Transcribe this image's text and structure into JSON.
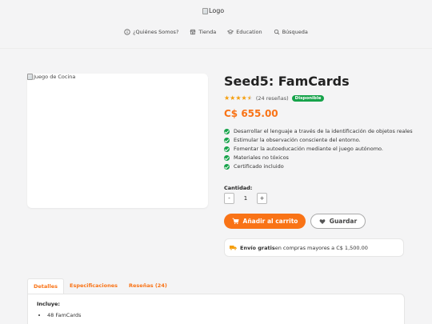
{
  "header": {
    "logo_alt": "Logo",
    "nav": [
      {
        "label": "¿Quiénes Somos?",
        "icon": "info-icon"
      },
      {
        "label": "Tienda",
        "icon": "store-icon"
      },
      {
        "label": "Education",
        "icon": "education-icon"
      },
      {
        "label": "Búsqueda",
        "icon": "search-icon"
      }
    ]
  },
  "product": {
    "image_alt": "Juego de Cocina",
    "title": "Seed5: FamCards",
    "rating": 4.5,
    "reviews": "(24 reseñas)",
    "stock_badge": "Disponible",
    "price": "C$ 655.00",
    "features": [
      "Desarrollar el lenguaje a través de la identificación de objetos reales",
      "Estimular la observación consciente del entorno.",
      "Fomentar la autoeducación mediante el juego autónomo.",
      "Materiales no tóxicos",
      "Certificado incluido"
    ],
    "quantity_label": "Cantidad:",
    "quantity": "1",
    "minus": "-",
    "plus": "+",
    "add_to_cart": "Añadir al carrito",
    "save": "Guardar",
    "shipping_bold": "Envío gratis",
    "shipping_rest": "en compras mayores a C$ 1,500.00"
  },
  "tabs": {
    "items": [
      "Detalles",
      "Especificaciones",
      "Reseñas (24)"
    ],
    "active": "Detalles",
    "includes_title": "Incluye:",
    "includes": [
      "48 FamCards"
    ]
  },
  "colors": {
    "accent": "#f97316",
    "star": "#f59e0b",
    "success": "#16a34a",
    "background": "#f4f4f5"
  }
}
